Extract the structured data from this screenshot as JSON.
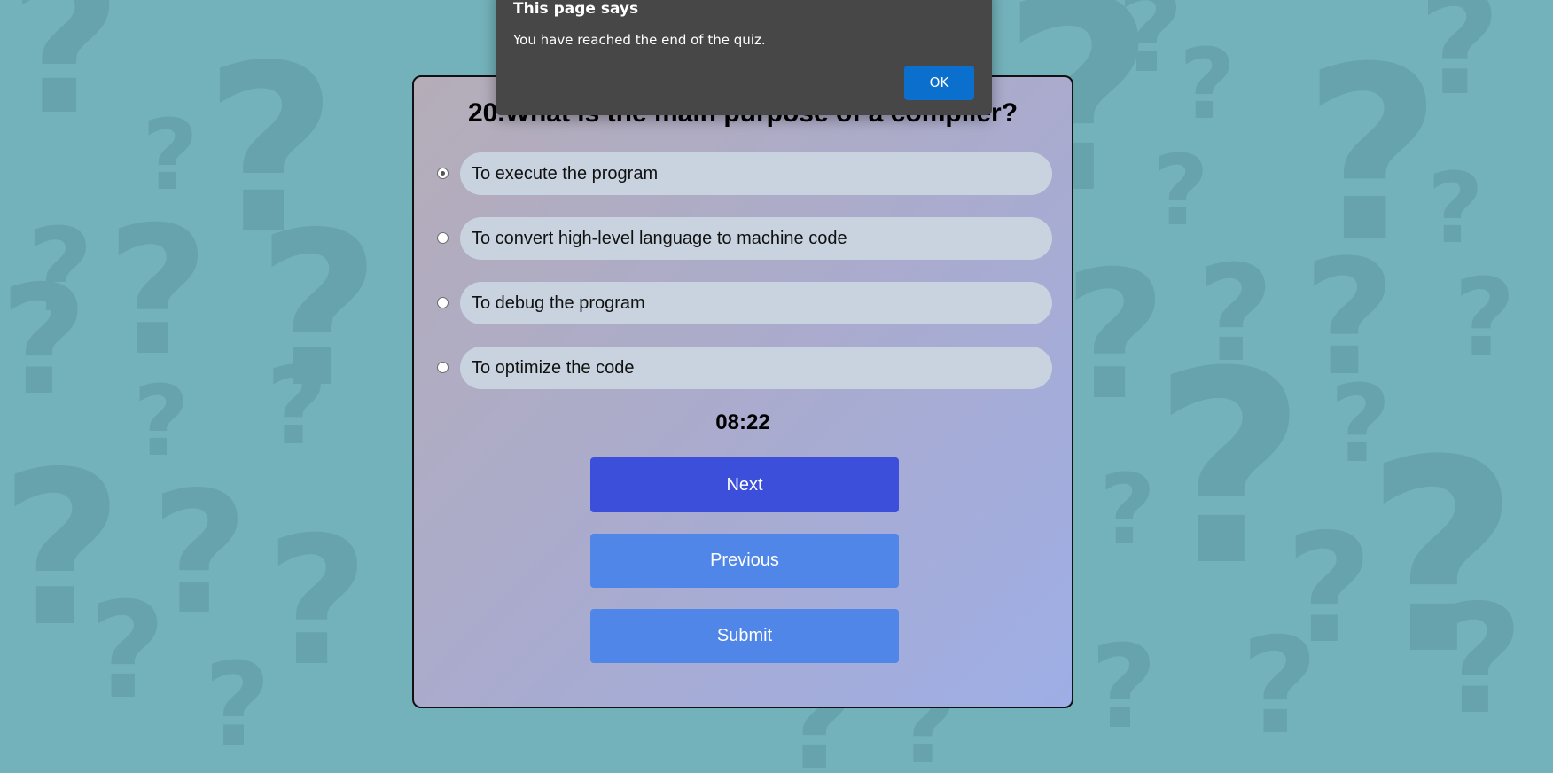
{
  "dialog": {
    "title": "This page says",
    "message": "You have reached the end of the quiz.",
    "ok_label": "OK"
  },
  "quiz": {
    "question": "20.What is the main purpose of a compiler?",
    "options": [
      {
        "label": "To execute the program",
        "selected": true
      },
      {
        "label": "To convert high-level language to machine code",
        "selected": false
      },
      {
        "label": "To debug the program",
        "selected": false
      },
      {
        "label": "To optimize the code",
        "selected": false
      }
    ],
    "timer": "08:22",
    "next_label": "Next",
    "previous_label": "Previous",
    "submit_label": "Submit"
  },
  "colors": {
    "page_background": "#74b2bb",
    "pattern": "#67a3ad",
    "next_button": "#3b4fdb",
    "secondary_button": "#4f86e8",
    "option_pill": "#c8d3df",
    "dialog_background": "#474747",
    "dialog_ok": "#0b6fce"
  },
  "background_icon": "question-mark-icon"
}
